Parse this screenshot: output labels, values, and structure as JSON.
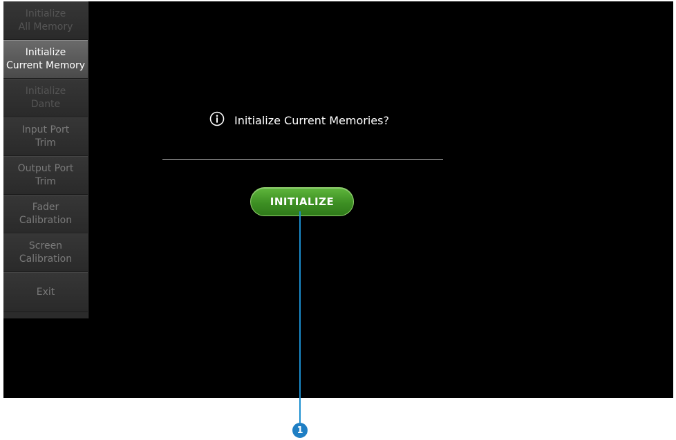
{
  "sidebar": {
    "items": [
      {
        "label": "Initialize\nAll Memory",
        "state": "disabled"
      },
      {
        "label": "Initialize\nCurrent Memory",
        "state": "active"
      },
      {
        "label": "Initialize\nDante",
        "state": "disabled"
      },
      {
        "label": "Input Port\nTrim",
        "state": "normal"
      },
      {
        "label": "Output Port\nTrim",
        "state": "normal"
      },
      {
        "label": "Fader\nCalibration",
        "state": "normal"
      },
      {
        "label": "Screen\nCalibration",
        "state": "normal"
      },
      {
        "label": "Exit",
        "state": "normal"
      }
    ]
  },
  "dialog": {
    "icon": "info-icon",
    "message": "Initialize Current Memories?",
    "button_label": "INITIALIZE",
    "button_color": "#3d8f23"
  },
  "callout": {
    "number": "1",
    "color": "#1f7fc4"
  }
}
